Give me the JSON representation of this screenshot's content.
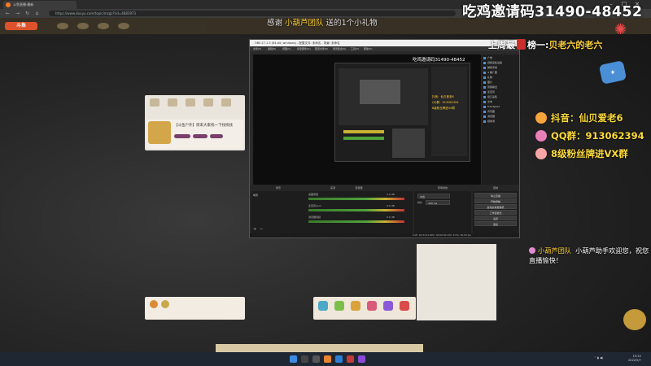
{
  "browser": {
    "tab_title": "斗鱼直播·最新",
    "url": "https://www.douyu.com/topic/mzgz?rid=4883973"
  },
  "overlay": {
    "invite_code": "吃鸡邀请码31490-48452",
    "top_caption_prefix": "感谢",
    "top_caption_user": "小葫芦团队",
    "top_caption_suffix": "送的1个小礼物",
    "weekly_prefix": "上周最",
    "weekly_rank": "榜一:",
    "weekly_name": "贝老六的老六",
    "promo": [
      {
        "text": "抖音：仙贝爱老6",
        "color": "#f5a53a"
      },
      {
        "text": "QQ群：913062394",
        "color": "#e87fb8"
      },
      {
        "text": "8级粉丝牌进VX群",
        "color": "#f7a6a6"
      }
    ],
    "thanks_user": "小葫芦团队",
    "thanks_text": "小葫芦助手欢迎您，祝您",
    "thanks_line2": "直播愉快！",
    "corner_logo_text": "斗鱼"
  },
  "douyu": {
    "card_title": "【斗鱼户外】周末大家找一下找找找",
    "watermark": "斗鱼",
    "watermark_sub": "DOUYU.COM"
  },
  "obs": {
    "title": "OBS 27.1.3 (64-bit, windows) - 配置文件: 未命名 - 场景: 未命名",
    "menu": [
      "文件(F)",
      "编辑(E)",
      "视图(V)",
      "停靠部件(D)",
      "配置文件(P)",
      "场景集合(S)",
      "工具(T)",
      "帮助(H)"
    ],
    "inner_caption": "吃鸡邀请码31490-48452",
    "inner_side": [
      "抖音：仙贝爱老6",
      "QQ群：913062394",
      "8级粉丝牌进VX群"
    ],
    "sources": [
      "广告",
      "视频采集设备",
      "弹幕浮层",
      "4 推广图",
      "礼物",
      "图片",
      "音频输出",
      "麦克风",
      "窗口采集",
      "文本",
      "FreeType2",
      "背景图",
      "浏览器",
      "媒体源"
    ],
    "docks": {
      "scenes": "场景",
      "sources": "来源",
      "mixer": "混音器",
      "transitions": "转场特效",
      "controls": "控制"
    },
    "scene_item": "场景",
    "mixer": [
      {
        "label": "桌面音频",
        "value": "0.0 dB"
      },
      {
        "label": "麦克风/Aux",
        "value": "0.0 dB"
      },
      {
        "label": "浏览器音频",
        "value": "0.0 dB"
      }
    ],
    "transition": {
      "name": "淡出",
      "duration_label": "时长",
      "duration": "300 ms"
    },
    "controls": [
      "停止直播",
      "开始录制",
      "启动虚拟摄像机",
      "工作室模式",
      "设置",
      "退出"
    ],
    "status": "LIVE: 00:34:12   REC: 00:00:00   CPU: 8.5%, 60.00 fps"
  },
  "taskbar": {
    "time": "19:14",
    "date": "2022/5/7"
  }
}
